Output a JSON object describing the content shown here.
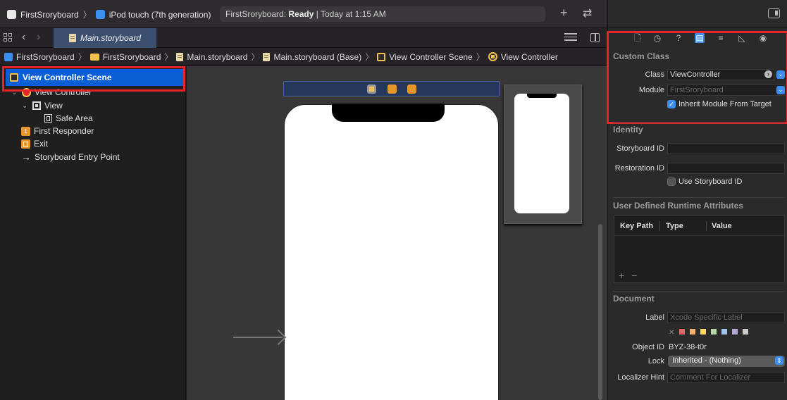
{
  "toolbar": {
    "scheme": "FirstSroryboard",
    "device": "iPod touch (7th generation)",
    "status_prefix": "FirstSroryboard:",
    "status_bold": "Ready",
    "status_suffix": "| Today at 1:15 AM",
    "add_icon": "plus-icon",
    "swap_icon": "swap-icon"
  },
  "tabs": [
    {
      "label": "Main.storyboard",
      "active": true
    }
  ],
  "breadcrumb": [
    "FirstSroryboard",
    "FirstSroryboard",
    "Main.storyboard",
    "Main.storyboard (Base)",
    "View Controller Scene",
    "View Controller"
  ],
  "outline": {
    "scene": "View Controller Scene",
    "items": [
      {
        "label": "View Controller"
      },
      {
        "label": "View"
      },
      {
        "label": "Safe Area"
      },
      {
        "label": "First Responder"
      },
      {
        "label": "Exit"
      },
      {
        "label": "Storyboard Entry Point"
      }
    ]
  },
  "inspector": {
    "custom_class": {
      "title": "Custom Class",
      "class_label": "Class",
      "class_value": "ViewController",
      "module_label": "Module",
      "module_placeholder": "FirstSroryboard",
      "inherit_label": "Inherit Module From Target",
      "inherit_checked": true
    },
    "identity": {
      "title": "Identity",
      "storyboard_id_label": "Storyboard ID",
      "storyboard_id_value": "",
      "restoration_id_label": "Restoration ID",
      "restoration_id_value": "",
      "use_storyboard_id_label": "Use Storyboard ID",
      "use_storyboard_id_checked": false
    },
    "runtime_attributes": {
      "title": "User Defined Runtime Attributes",
      "columns": [
        "Key Path",
        "Type",
        "Value"
      ],
      "rows": [],
      "add": "+",
      "remove": "−"
    },
    "document": {
      "title": "Document",
      "label_label": "Label",
      "label_placeholder": "Xcode Specific Label",
      "swatch_colors": [
        "#e06666",
        "#f6b26b",
        "#ffd966",
        "#b6d7a8",
        "#9fc5e8",
        "#b4a7d6",
        "#cccccc"
      ],
      "object_id_label": "Object ID",
      "object_id_value": "BYZ-38-t0r",
      "lock_label": "Lock",
      "lock_value": "Inherited - (Nothing)",
      "localizer_hint_label": "Localizer Hint",
      "localizer_hint_placeholder": "Comment For Localizer"
    }
  },
  "colors": {
    "accent": "#3b8ff0",
    "selection": "#0a5fd6",
    "highlight_box": "#e8252a"
  }
}
